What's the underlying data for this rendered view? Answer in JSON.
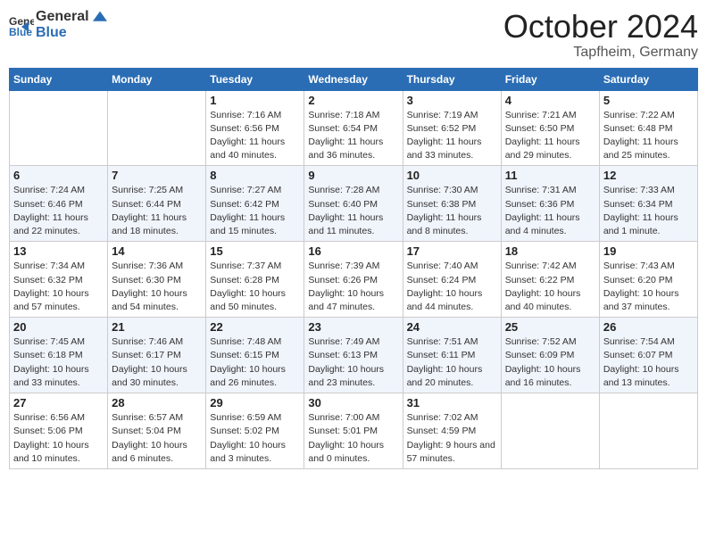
{
  "header": {
    "logo_line1": "General",
    "logo_line2": "Blue",
    "month": "October 2024",
    "location": "Tapfheim, Germany"
  },
  "days_of_week": [
    "Sunday",
    "Monday",
    "Tuesday",
    "Wednesday",
    "Thursday",
    "Friday",
    "Saturday"
  ],
  "weeks": [
    [
      {
        "day": "",
        "text": ""
      },
      {
        "day": "",
        "text": ""
      },
      {
        "day": "1",
        "text": "Sunrise: 7:16 AM\nSunset: 6:56 PM\nDaylight: 11 hours and 40 minutes."
      },
      {
        "day": "2",
        "text": "Sunrise: 7:18 AM\nSunset: 6:54 PM\nDaylight: 11 hours and 36 minutes."
      },
      {
        "day": "3",
        "text": "Sunrise: 7:19 AM\nSunset: 6:52 PM\nDaylight: 11 hours and 33 minutes."
      },
      {
        "day": "4",
        "text": "Sunrise: 7:21 AM\nSunset: 6:50 PM\nDaylight: 11 hours and 29 minutes."
      },
      {
        "day": "5",
        "text": "Sunrise: 7:22 AM\nSunset: 6:48 PM\nDaylight: 11 hours and 25 minutes."
      }
    ],
    [
      {
        "day": "6",
        "text": "Sunrise: 7:24 AM\nSunset: 6:46 PM\nDaylight: 11 hours and 22 minutes."
      },
      {
        "day": "7",
        "text": "Sunrise: 7:25 AM\nSunset: 6:44 PM\nDaylight: 11 hours and 18 minutes."
      },
      {
        "day": "8",
        "text": "Sunrise: 7:27 AM\nSunset: 6:42 PM\nDaylight: 11 hours and 15 minutes."
      },
      {
        "day": "9",
        "text": "Sunrise: 7:28 AM\nSunset: 6:40 PM\nDaylight: 11 hours and 11 minutes."
      },
      {
        "day": "10",
        "text": "Sunrise: 7:30 AM\nSunset: 6:38 PM\nDaylight: 11 hours and 8 minutes."
      },
      {
        "day": "11",
        "text": "Sunrise: 7:31 AM\nSunset: 6:36 PM\nDaylight: 11 hours and 4 minutes."
      },
      {
        "day": "12",
        "text": "Sunrise: 7:33 AM\nSunset: 6:34 PM\nDaylight: 11 hours and 1 minute."
      }
    ],
    [
      {
        "day": "13",
        "text": "Sunrise: 7:34 AM\nSunset: 6:32 PM\nDaylight: 10 hours and 57 minutes."
      },
      {
        "day": "14",
        "text": "Sunrise: 7:36 AM\nSunset: 6:30 PM\nDaylight: 10 hours and 54 minutes."
      },
      {
        "day": "15",
        "text": "Sunrise: 7:37 AM\nSunset: 6:28 PM\nDaylight: 10 hours and 50 minutes."
      },
      {
        "day": "16",
        "text": "Sunrise: 7:39 AM\nSunset: 6:26 PM\nDaylight: 10 hours and 47 minutes."
      },
      {
        "day": "17",
        "text": "Sunrise: 7:40 AM\nSunset: 6:24 PM\nDaylight: 10 hours and 44 minutes."
      },
      {
        "day": "18",
        "text": "Sunrise: 7:42 AM\nSunset: 6:22 PM\nDaylight: 10 hours and 40 minutes."
      },
      {
        "day": "19",
        "text": "Sunrise: 7:43 AM\nSunset: 6:20 PM\nDaylight: 10 hours and 37 minutes."
      }
    ],
    [
      {
        "day": "20",
        "text": "Sunrise: 7:45 AM\nSunset: 6:18 PM\nDaylight: 10 hours and 33 minutes."
      },
      {
        "day": "21",
        "text": "Sunrise: 7:46 AM\nSunset: 6:17 PM\nDaylight: 10 hours and 30 minutes."
      },
      {
        "day": "22",
        "text": "Sunrise: 7:48 AM\nSunset: 6:15 PM\nDaylight: 10 hours and 26 minutes."
      },
      {
        "day": "23",
        "text": "Sunrise: 7:49 AM\nSunset: 6:13 PM\nDaylight: 10 hours and 23 minutes."
      },
      {
        "day": "24",
        "text": "Sunrise: 7:51 AM\nSunset: 6:11 PM\nDaylight: 10 hours and 20 minutes."
      },
      {
        "day": "25",
        "text": "Sunrise: 7:52 AM\nSunset: 6:09 PM\nDaylight: 10 hours and 16 minutes."
      },
      {
        "day": "26",
        "text": "Sunrise: 7:54 AM\nSunset: 6:07 PM\nDaylight: 10 hours and 13 minutes."
      }
    ],
    [
      {
        "day": "27",
        "text": "Sunrise: 6:56 AM\nSunset: 5:06 PM\nDaylight: 10 hours and 10 minutes."
      },
      {
        "day": "28",
        "text": "Sunrise: 6:57 AM\nSunset: 5:04 PM\nDaylight: 10 hours and 6 minutes."
      },
      {
        "day": "29",
        "text": "Sunrise: 6:59 AM\nSunset: 5:02 PM\nDaylight: 10 hours and 3 minutes."
      },
      {
        "day": "30",
        "text": "Sunrise: 7:00 AM\nSunset: 5:01 PM\nDaylight: 10 hours and 0 minutes."
      },
      {
        "day": "31",
        "text": "Sunrise: 7:02 AM\nSunset: 4:59 PM\nDaylight: 9 hours and 57 minutes."
      },
      {
        "day": "",
        "text": ""
      },
      {
        "day": "",
        "text": ""
      }
    ]
  ]
}
